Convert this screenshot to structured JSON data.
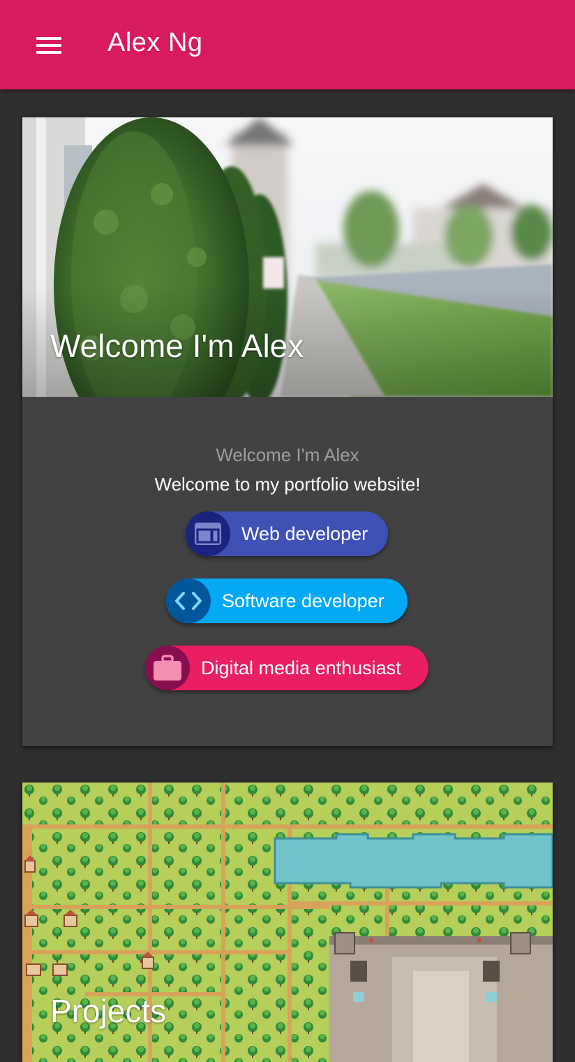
{
  "app_bar": {
    "title": "Alex Ng",
    "menu_icon": "hamburger-menu-icon",
    "color": "#d81b60"
  },
  "welcome_card": {
    "hero_title": "Welcome I'm Alex",
    "subtitle": "Welcome I'm Alex",
    "tagline": "Welcome to my portfolio website!",
    "chips": [
      {
        "label": "Web developer",
        "icon": "web-browser-icon",
        "color": "#3f51b5",
        "avatar_color": "#1a237e"
      },
      {
        "label": "Software developer",
        "icon": "code-brackets-icon",
        "color": "#03a9f4",
        "avatar_color": "#01579b"
      },
      {
        "label": "Digital media enthusiast",
        "icon": "briefcase-icon",
        "color": "#e91e63",
        "avatar_color": "#880e4f"
      }
    ]
  },
  "projects_card": {
    "title": "Projects"
  },
  "colors": {
    "background": "#303030",
    "card": "#424242"
  }
}
